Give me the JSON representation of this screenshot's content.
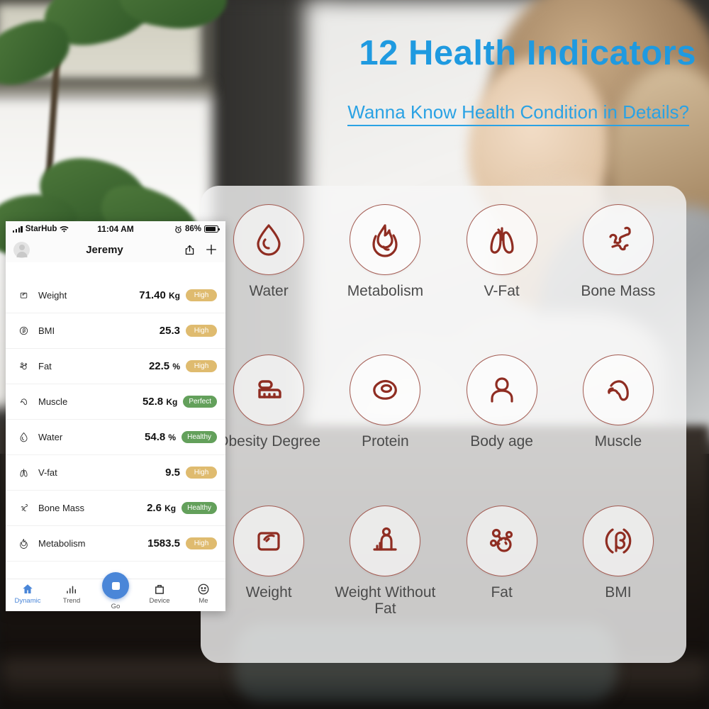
{
  "promo": {
    "headline": "12 Health Indicators",
    "subheadline": "Wanna Know Health Condition in Details?",
    "accent_blue": "#1f9ae0",
    "icon_red": "#8f2d22"
  },
  "indicators": [
    {
      "label": "Water",
      "icon": "water-drop-icon"
    },
    {
      "label": "Metabolism",
      "icon": "flame-icon"
    },
    {
      "label": "V-Fat",
      "icon": "lungs-icon"
    },
    {
      "label": "Bone Mass",
      "icon": "bones-icon"
    },
    {
      "label": "Obesity Degree",
      "icon": "obesity-blocks-icon"
    },
    {
      "label": "Protein",
      "icon": "protein-cell-icon"
    },
    {
      "label": "Body age",
      "icon": "person-icon"
    },
    {
      "label": "Muscle",
      "icon": "flexed-arm-icon"
    },
    {
      "label": "Weight",
      "icon": "scale-icon"
    },
    {
      "label": "Weight Without Fat",
      "icon": "body-chart-icon"
    },
    {
      "label": "Fat",
      "icon": "fat-cells-icon"
    },
    {
      "label": "BMI",
      "icon": "bmi-beta-icon"
    }
  ],
  "phone": {
    "status_bar": {
      "carrier": "StarHub",
      "time": "11:04 AM",
      "battery_percent": "86%"
    },
    "nav": {
      "title": "Jeremy",
      "share_icon": "share-icon",
      "add_icon": "plus-icon"
    },
    "metrics": [
      {
        "name": "Weight",
        "value": "71.40",
        "unit": "Kg",
        "status": "High",
        "status_type": "high",
        "icon": "scale-icon"
      },
      {
        "name": "BMI",
        "value": "25.3",
        "unit": "",
        "status": "High",
        "status_type": "high",
        "icon": "bmi-beta-icon"
      },
      {
        "name": "Fat",
        "value": "22.5",
        "unit": "%",
        "status": "High",
        "status_type": "high",
        "icon": "fat-cells-icon"
      },
      {
        "name": "Muscle",
        "value": "52.8",
        "unit": "Kg",
        "status": "Perfect",
        "status_type": "good",
        "icon": "flexed-arm-icon"
      },
      {
        "name": "Water",
        "value": "54.8",
        "unit": "%",
        "status": "Healthy",
        "status_type": "good",
        "icon": "water-drop-icon"
      },
      {
        "name": "V-fat",
        "value": "9.5",
        "unit": "",
        "status": "High",
        "status_type": "high",
        "icon": "lungs-icon"
      },
      {
        "name": "Bone Mass",
        "value": "2.6",
        "unit": "Kg",
        "status": "Healthy",
        "status_type": "good",
        "icon": "bones-icon"
      },
      {
        "name": "Metabolism",
        "value": "1583.5",
        "unit": "",
        "status": "High",
        "status_type": "high",
        "icon": "flame-icon"
      }
    ],
    "tabs": [
      {
        "label": "Dynamic",
        "icon": "home-icon",
        "active": true
      },
      {
        "label": "Trend",
        "icon": "bar-chart-icon",
        "active": false
      },
      {
        "label": "Go",
        "icon": "scale-icon",
        "active": false
      },
      {
        "label": "Device",
        "icon": "device-icon",
        "active": false
      },
      {
        "label": "Me",
        "icon": "smiley-icon",
        "active": false
      }
    ],
    "badge_colors": {
      "high": "#dfbb6f",
      "good": "#63a05b"
    },
    "accent": "#4a86d8"
  }
}
